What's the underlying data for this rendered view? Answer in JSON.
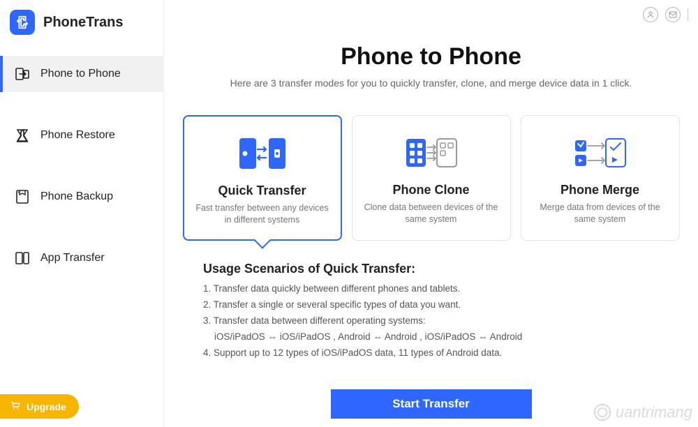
{
  "app": {
    "name": "PhoneTrans"
  },
  "sidebar": {
    "items": [
      {
        "label": "Phone to Phone",
        "active": true
      },
      {
        "label": "Phone Restore",
        "active": false
      },
      {
        "label": "Phone Backup",
        "active": false
      },
      {
        "label": "App Transfer",
        "active": false
      }
    ],
    "upgrade_label": "Upgrade"
  },
  "header": {
    "title": "Phone to Phone",
    "subtitle": "Here are 3 transfer modes for you to quickly transfer, clone, and merge device data in 1 click."
  },
  "cards": [
    {
      "title": "Quick Transfer",
      "desc": "Fast transfer between any devices in different systems",
      "selected": true
    },
    {
      "title": "Phone Clone",
      "desc": "Clone data between devices of the same system",
      "selected": false
    },
    {
      "title": "Phone Merge",
      "desc": "Merge data from devices of the same system",
      "selected": false
    }
  ],
  "scenarios": {
    "title": "Usage Scenarios of Quick Transfer:",
    "lines": [
      "1. Transfer data quickly between different phones and tablets.",
      "2. Transfer a single or several specific types of data you want.",
      "3. Transfer data between different operating systems:",
      "iOS/iPadOS ⇔ iOS/iPadOS ,  Android ⇔ Android ,  iOS/iPadOS ⇔ Android",
      "4. Support up to 12 types of iOS/iPadOS data, 11 types of Android data."
    ]
  },
  "action": {
    "start_label": "Start Transfer"
  },
  "watermark": "uantrimang"
}
